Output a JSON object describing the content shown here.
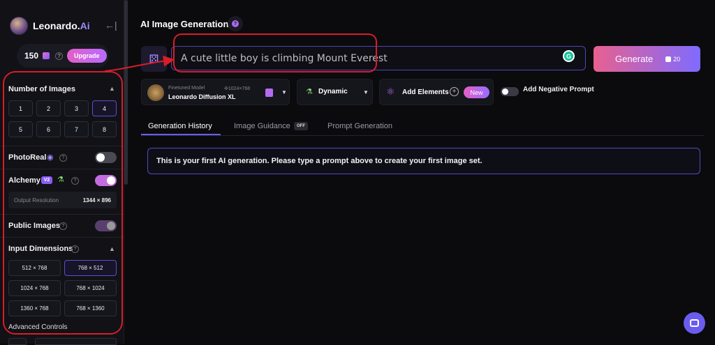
{
  "sidebar": {
    "brand_name": "Leonardo.",
    "brand_ai": "Ai",
    "collapse_icon": "←|",
    "tokens": "150",
    "upgrade_label": "Upgrade",
    "number_of_images": {
      "label": "Number of Images",
      "options": [
        "1",
        "2",
        "3",
        "4",
        "5",
        "6",
        "7",
        "8"
      ],
      "selected": "4"
    },
    "photoreal": {
      "label": "PhotoReal",
      "enabled": false
    },
    "alchemy": {
      "label": "Alchemy",
      "badge": "V2",
      "enabled": true
    },
    "output_resolution": {
      "label": "Output Resolution",
      "value": "1344 × 896"
    },
    "public_images": {
      "label": "Public Images",
      "enabled": true
    },
    "input_dimensions": {
      "label": "Input Dimensions",
      "options": [
        "512 × 768",
        "768 × 512",
        "1024 × 768",
        "768 × 1024",
        "1360 × 768",
        "768 × 1360"
      ],
      "selected": "768 × 512"
    },
    "advanced_controls": "Advanced Controls"
  },
  "header": {
    "title": "AI Image Generation",
    "info_icon": "?"
  },
  "prompt": {
    "value": "A cute little boy is climbing Mount Everest",
    "grammarly": "G"
  },
  "generate": {
    "label": "Generate",
    "cost": "20"
  },
  "model": {
    "caption": "Finetuned Model",
    "size": "✣1024×768",
    "name": "Leonardo Diffusion XL"
  },
  "style": {
    "label": "Dynamic"
  },
  "elements": {
    "label": "Add Elements",
    "badge": "New",
    "plus": "+"
  },
  "negative_prompt": {
    "label": "Add Negative Prompt",
    "enabled": false
  },
  "tabs": [
    {
      "label": "Generation History",
      "active": true
    },
    {
      "label": "Image Guidance",
      "badge": "OFF"
    },
    {
      "label": "Prompt Generation"
    }
  ],
  "notice": "This is your first AI generation. Please type a prompt above to create your first image set.",
  "colors": {
    "accent": "#6a5cff",
    "annotation_red": "#d71d29",
    "generate_start": "#e86090",
    "generate_end": "#7f6bff"
  }
}
